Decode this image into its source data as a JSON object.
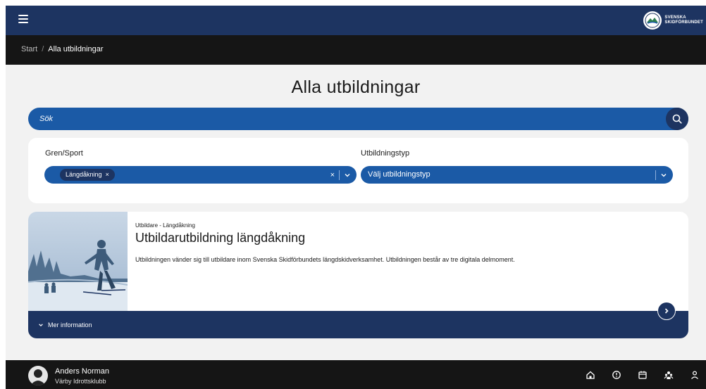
{
  "breadcrumb": {
    "home": "Start",
    "separator": "/",
    "current": "Alla utbildningar"
  },
  "page": {
    "title": "Alla utbildningar"
  },
  "search": {
    "label": "Sök",
    "icon": "search-icon"
  },
  "filters": {
    "sport": {
      "label": "Gren/Sport",
      "selected_chip": "Längdåkning",
      "chip_remove": "×",
      "clear": "×"
    },
    "type": {
      "label": "Utbildningstyp",
      "placeholder": "Välj utbildningstyp"
    }
  },
  "course": {
    "kicker": "Utbildare - Längdåkning",
    "title": "Utbildarutbildning längdåkning",
    "description": "Utbildningen vänder sig till utbildare inom Svenska Skidförbundets längdskidverksamhet. Utbildningen består av tre digitala delmoment.",
    "more_label": "Mer information"
  },
  "logo": {
    "line1": "SVENSKA",
    "line2": "SKIDFÖRBUNDET"
  },
  "user": {
    "name": "Anders Norman",
    "club": "Värby Idrottsklubb"
  },
  "footer_icons": [
    "home-icon",
    "clock-icon",
    "calendar-icon",
    "users-icon",
    "person-icon"
  ],
  "colors": {
    "navy": "#1d3461",
    "blue": "#1b5aa6",
    "dark": "#151515"
  }
}
